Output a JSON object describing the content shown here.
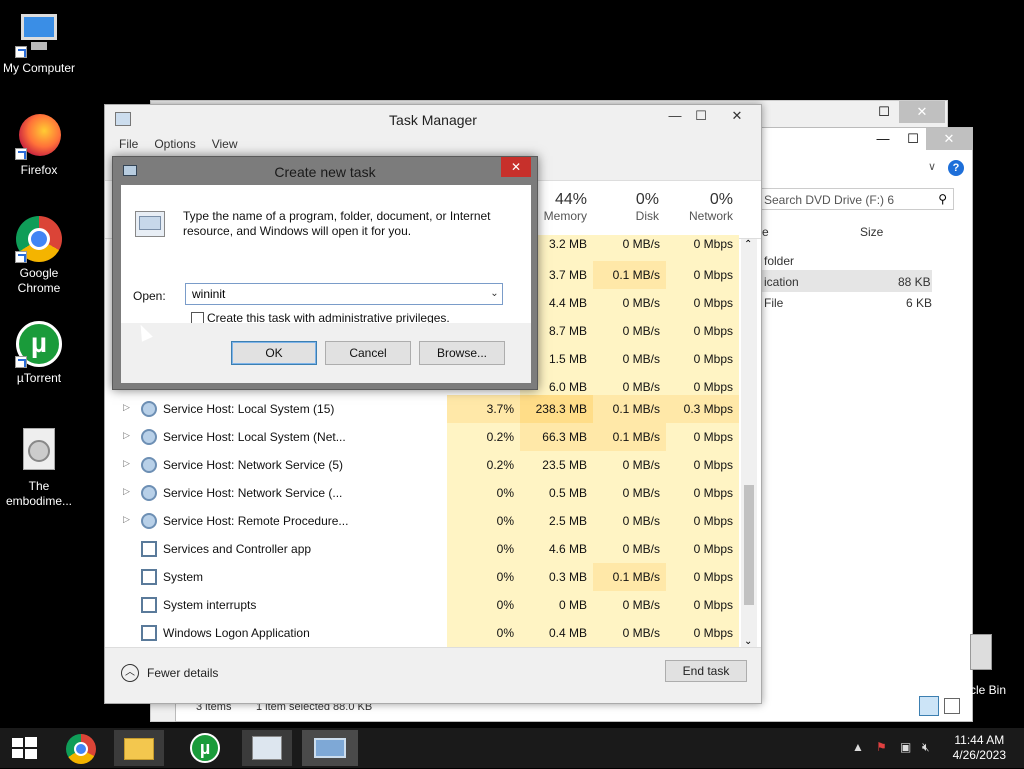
{
  "desktop": {
    "icons": [
      {
        "label": "My Computer"
      },
      {
        "label": "Firefox"
      },
      {
        "label": "Google Chrome"
      },
      {
        "label": "µTorrent"
      },
      {
        "label": "The embodime..."
      }
    ],
    "recycle_bin_partial": "cle Bin"
  },
  "explorer": {
    "search_placeholder": "Search DVD Drive (F:) 6",
    "col_size": "Size",
    "row1": "folder",
    "row2_name": "ication",
    "row2_size": "88 KB",
    "row3_name": "File",
    "row3_size": "6 KB",
    "status_items": "3 items",
    "status_selected": "1 item selected  88.0 KB"
  },
  "task_manager": {
    "title": "Task Manager",
    "menu": [
      "File",
      "Options",
      "View"
    ],
    "columns": {
      "memory_pct": "44%",
      "memory_label": "Memory",
      "disk_pct": "0%",
      "disk_label": "Disk",
      "network_pct": "0%",
      "network_label": "Network"
    },
    "hidden_rows": [
      {
        "mem": "3.2 MB",
        "disk": "0 MB/s",
        "net": "0 Mbps"
      },
      {
        "mem": "3.7 MB",
        "disk": "0.1 MB/s",
        "net": "0 Mbps"
      },
      {
        "mem": "4.4 MB",
        "disk": "0 MB/s",
        "net": "0 Mbps"
      },
      {
        "mem": "8.7 MB",
        "disk": "0 MB/s",
        "net": "0 Mbps"
      },
      {
        "mem": "1.5 MB",
        "disk": "0 MB/s",
        "net": "0 Mbps"
      },
      {
        "mem": "6.0 MB",
        "disk": "0 MB/s",
        "net": "0 Mbps"
      }
    ],
    "rows": [
      {
        "name": "Service Host: Local System (15)",
        "cpu": "3.7%",
        "mem": "238.3 MB",
        "disk": "0.1 MB/s",
        "net": "0.3 Mbps"
      },
      {
        "name": "Service Host: Local System (Net...",
        "cpu": "0.2%",
        "mem": "66.3 MB",
        "disk": "0.1 MB/s",
        "net": "0 Mbps"
      },
      {
        "name": "Service Host: Network Service (5)",
        "cpu": "0.2%",
        "mem": "23.5 MB",
        "disk": "0 MB/s",
        "net": "0 Mbps"
      },
      {
        "name": "Service Host: Network Service (...",
        "cpu": "0%",
        "mem": "0.5 MB",
        "disk": "0 MB/s",
        "net": "0 Mbps"
      },
      {
        "name": "Service Host: Remote Procedure...",
        "cpu": "0%",
        "mem": "2.5 MB",
        "disk": "0 MB/s",
        "net": "0 Mbps"
      },
      {
        "name": "Services and Controller app",
        "cpu": "0%",
        "mem": "4.6 MB",
        "disk": "0 MB/s",
        "net": "0 Mbps"
      },
      {
        "name": "System",
        "cpu": "0%",
        "mem": "0.3 MB",
        "disk": "0.1 MB/s",
        "net": "0 Mbps"
      },
      {
        "name": "System interrupts",
        "cpu": "0%",
        "mem": "0 MB",
        "disk": "0 MB/s",
        "net": "0 Mbps"
      },
      {
        "name": "Windows Logon Application",
        "cpu": "0%",
        "mem": "0.4 MB",
        "disk": "0 MB/s",
        "net": "0 Mbps"
      }
    ],
    "fewer_details": "Fewer details",
    "end_task": "End task"
  },
  "dialog": {
    "title": "Create new task",
    "message": "Type the name of a program, folder, document, or Internet resource, and Windows will open it for you.",
    "open_label": "Open:",
    "open_value": "wininit",
    "admin_label": "Create this task with administrative privileges.",
    "ok": "OK",
    "cancel": "Cancel",
    "browse": "Browse..."
  },
  "taskbar": {
    "time": "11:44 AM",
    "date": "4/26/2023"
  }
}
